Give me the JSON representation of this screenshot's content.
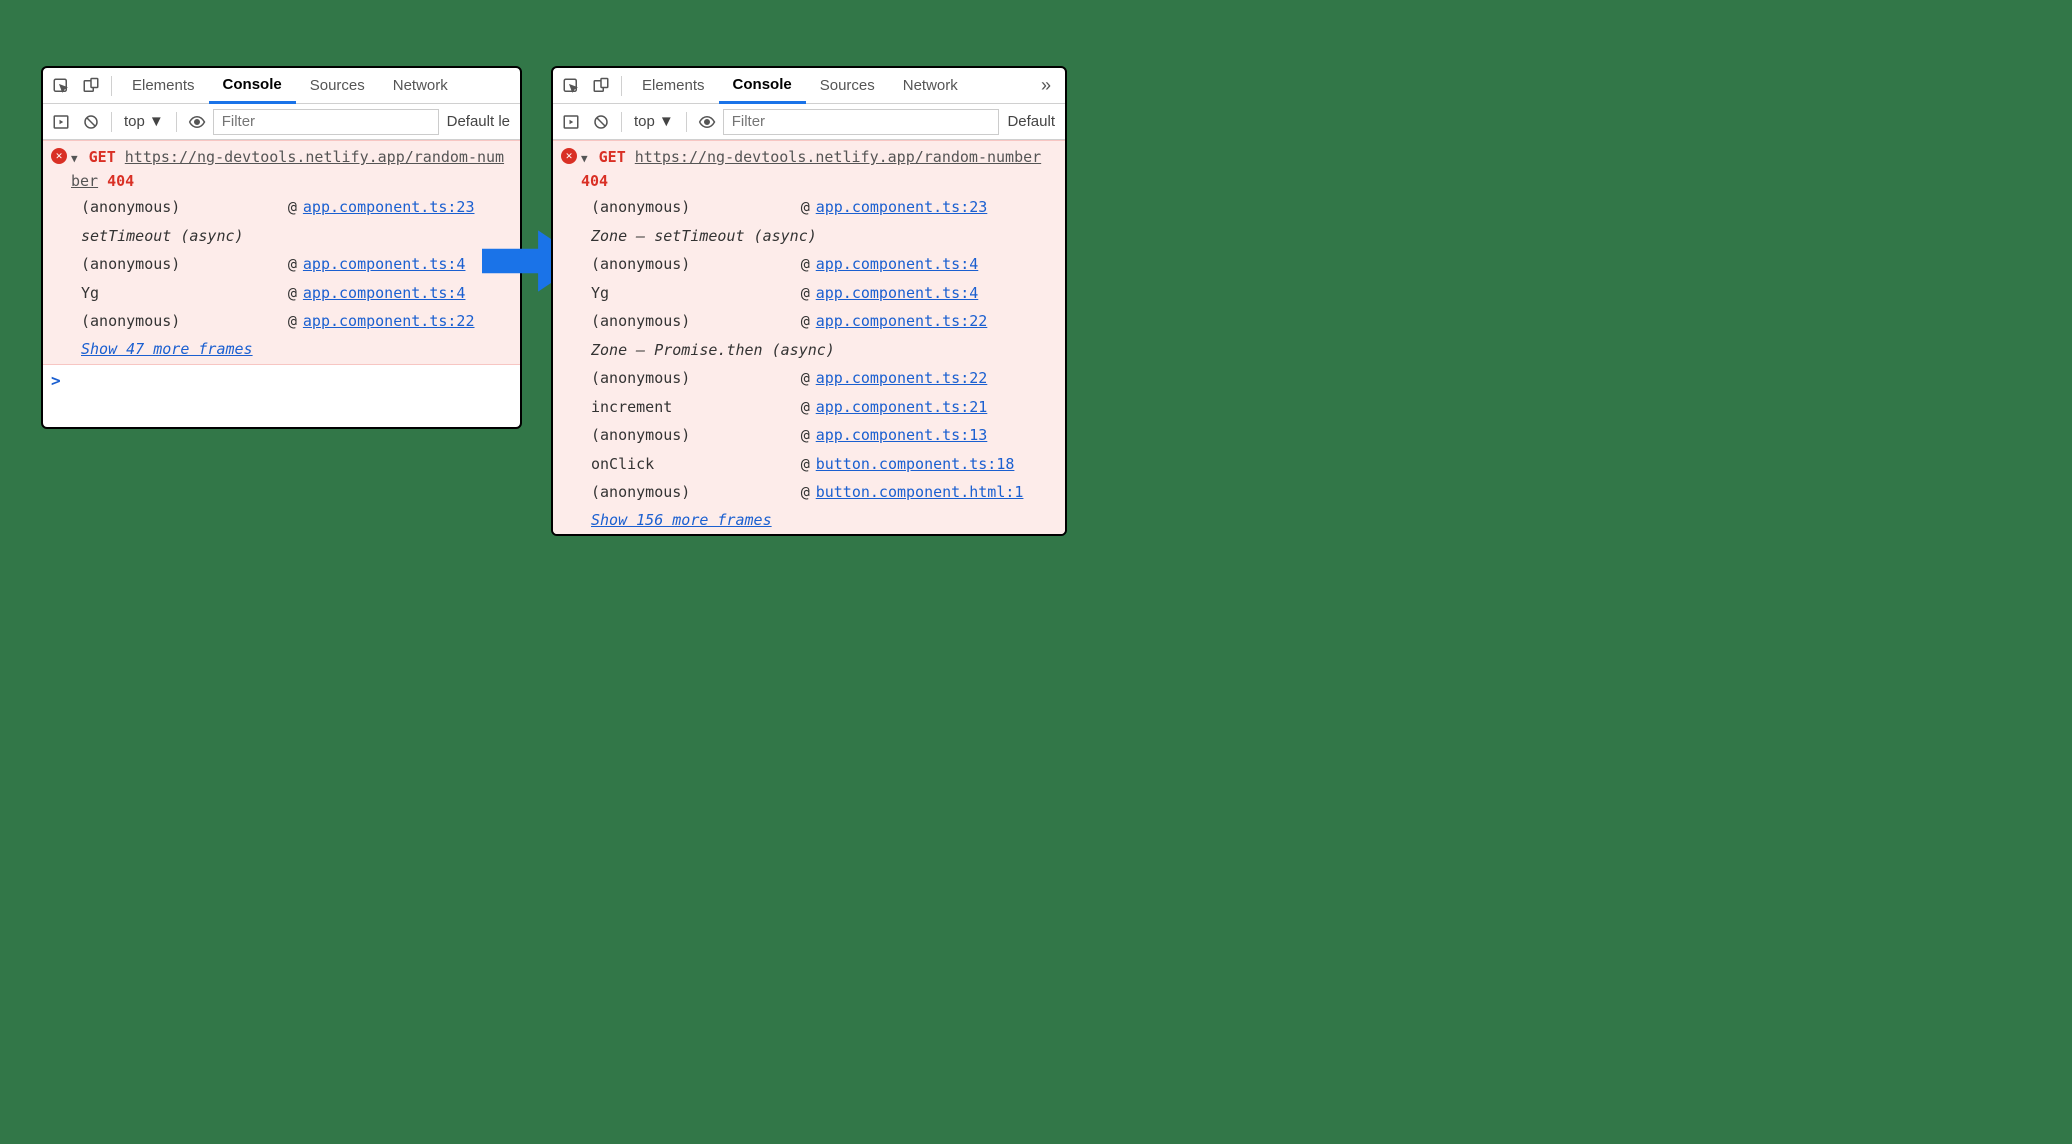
{
  "tabs": {
    "elements": "Elements",
    "console": "Console",
    "sources": "Sources",
    "network": "Network",
    "more": "»"
  },
  "toolbar": {
    "context": "top",
    "filter_placeholder": "Filter",
    "levels_left": "Default le",
    "levels_right": "Default"
  },
  "error": {
    "method": "GET",
    "status": "404",
    "url_left": "https://ng-devtools.netlify.app/random-number",
    "url_right": "https://ng-devtools.netlify.app/random-number"
  },
  "left": {
    "rows": [
      {
        "fn": "(anonymous)",
        "link": "app.component.ts:23"
      },
      {
        "zone": "setTimeout (async)"
      },
      {
        "fn": "(anonymous)",
        "link": "app.component.ts:4"
      },
      {
        "fn": "Yg",
        "link": "app.component.ts:4"
      },
      {
        "fn": "(anonymous)",
        "link": "app.component.ts:22"
      }
    ],
    "show_more": "Show 47 more frames"
  },
  "right": {
    "rows": [
      {
        "fn": "(anonymous)",
        "link": "app.component.ts:23"
      },
      {
        "zone": "Zone — setTimeout (async)"
      },
      {
        "fn": "(anonymous)",
        "link": "app.component.ts:4"
      },
      {
        "fn": "Yg",
        "link": "app.component.ts:4"
      },
      {
        "fn": "(anonymous)",
        "link": "app.component.ts:22"
      },
      {
        "zone": "Zone — Promise.then (async)"
      },
      {
        "fn": "(anonymous)",
        "link": "app.component.ts:22"
      },
      {
        "fn": "increment",
        "link": "app.component.ts:21"
      },
      {
        "fn": "(anonymous)",
        "link": "app.component.ts:13"
      },
      {
        "fn": "onClick",
        "link": "button.component.ts:18"
      },
      {
        "fn": "(anonymous)",
        "link": "button.component.html:1"
      }
    ],
    "show_more": "Show 156 more frames"
  },
  "prompt": ">"
}
